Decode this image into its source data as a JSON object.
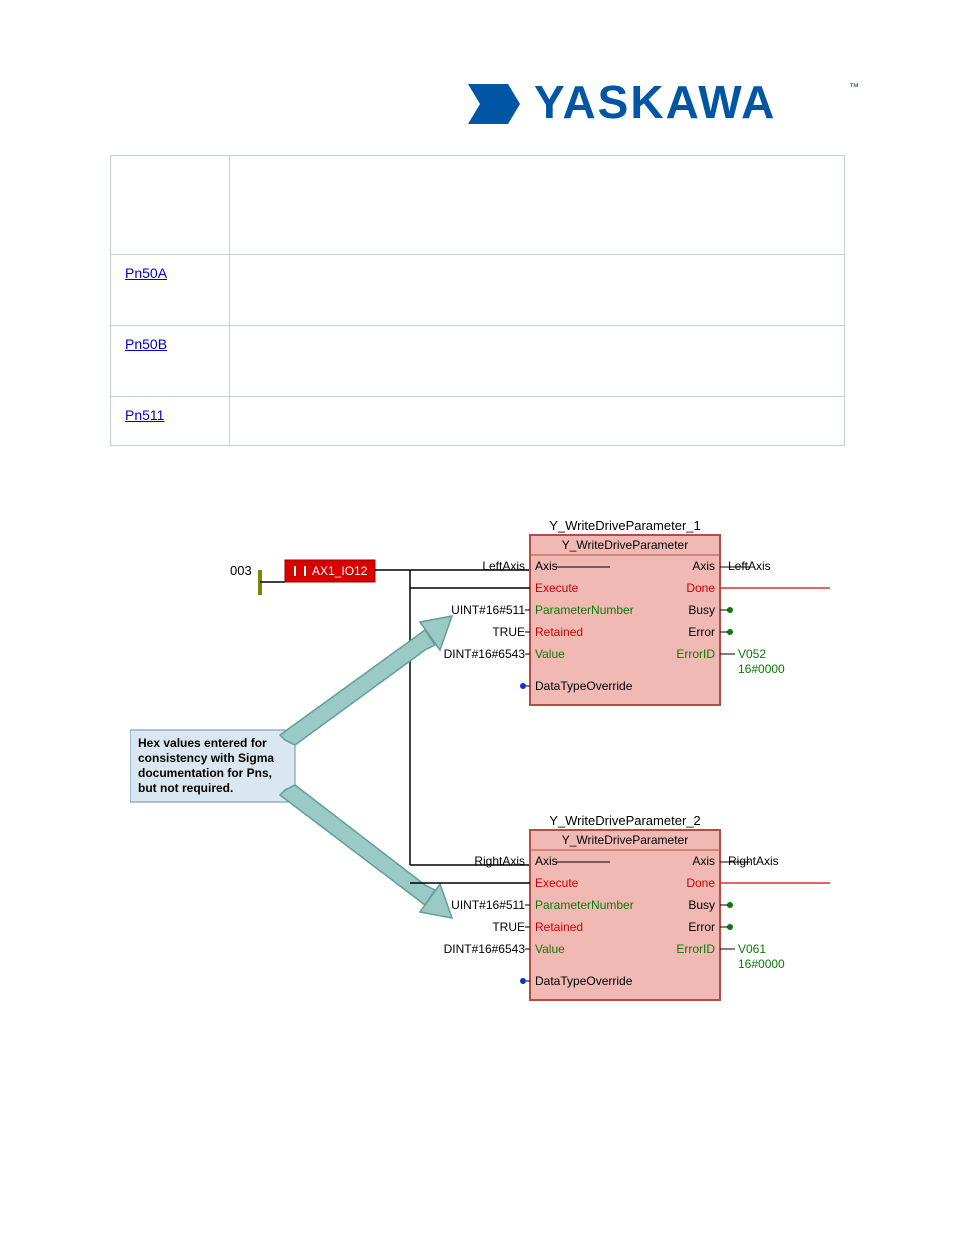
{
  "logo": {
    "text": "YASKAWA",
    "brand_color": "#0055a5"
  },
  "table": {
    "rows": [
      {
        "pn": "",
        "desc": ""
      },
      {
        "pn": "Pn50A",
        "desc": ""
      },
      {
        "pn": "Pn50B",
        "desc": ""
      },
      {
        "pn": "Pn511",
        "desc": ""
      }
    ]
  },
  "diagram": {
    "rung_label": "003",
    "contact_label": "AX1_IO12",
    "note": {
      "lines": [
        "Hex values entered for",
        "consistency with Sigma",
        "documentation for Pns,",
        "but not required."
      ]
    },
    "blocks": [
      {
        "instance": "Y_WriteDriveParameter_1",
        "type": "Y_WriteDriveParameter",
        "axis_in": "LeftAxis",
        "axis_out": "LeftAxis",
        "left_rows": [
          {
            "label": "",
            "pin": "Axis",
            "color": "#000"
          },
          {
            "label": "",
            "pin": "Execute",
            "color": "#cc0000"
          },
          {
            "label": "UINT#16#511",
            "pin": "ParameterNumber",
            "color": "#0a7a0a"
          },
          {
            "label": "TRUE",
            "pin": "Retained",
            "color": "#cc0000"
          },
          {
            "label": "DINT#16#6543",
            "pin": "Value",
            "color": "#0a7a0a"
          },
          {
            "label": "",
            "pin": "DataTypeOverride",
            "color": "#000"
          }
        ],
        "right_rows": [
          {
            "pin": "Axis",
            "out": "",
            "color": "#000"
          },
          {
            "pin": "Done",
            "out": "",
            "color": "#cc0000"
          },
          {
            "pin": "Busy",
            "out": "",
            "color": "#000"
          },
          {
            "pin": "Error",
            "out": "",
            "color": "#000"
          },
          {
            "pin": "ErrorID",
            "out": "V052",
            "color": "#0a7a0a"
          },
          {
            "pin": "",
            "out": "16#0000",
            "color": "#0a7a0a"
          }
        ]
      },
      {
        "instance": "Y_WriteDriveParameter_2",
        "type": "Y_WriteDriveParameter",
        "axis_in": "RightAxis",
        "axis_out": "RightAxis",
        "left_rows": [
          {
            "label": "",
            "pin": "Axis",
            "color": "#000"
          },
          {
            "label": "",
            "pin": "Execute",
            "color": "#cc0000"
          },
          {
            "label": "UINT#16#511",
            "pin": "ParameterNumber",
            "color": "#0a7a0a"
          },
          {
            "label": "TRUE",
            "pin": "Retained",
            "color": "#cc0000"
          },
          {
            "label": "DINT#16#6543",
            "pin": "Value",
            "color": "#0a7a0a"
          },
          {
            "label": "",
            "pin": "DataTypeOverride",
            "color": "#000"
          }
        ],
        "right_rows": [
          {
            "pin": "Axis",
            "out": "",
            "color": "#000"
          },
          {
            "pin": "Done",
            "out": "",
            "color": "#cc0000"
          },
          {
            "pin": "Busy",
            "out": "",
            "color": "#000"
          },
          {
            "pin": "Error",
            "out": "",
            "color": "#000"
          },
          {
            "pin": "ErrorID",
            "out": "V061",
            "color": "#0a7a0a"
          },
          {
            "pin": "",
            "out": "16#0000",
            "color": "#0a7a0a"
          }
        ]
      }
    ]
  },
  "colors": {
    "contact_fill": "#d80000",
    "contact_text": "#ffffff",
    "block_fill": "#f1b9b4",
    "block_stroke": "#b74c44",
    "note_fill": "#dbe7f0",
    "note_stroke": "#6a8ea8",
    "arrow_fill": "#9bc9c5",
    "arrow_stroke": "#5ea09a",
    "green": "#0a7a0a",
    "red": "#cc0000",
    "wire_red": "#e03030"
  }
}
